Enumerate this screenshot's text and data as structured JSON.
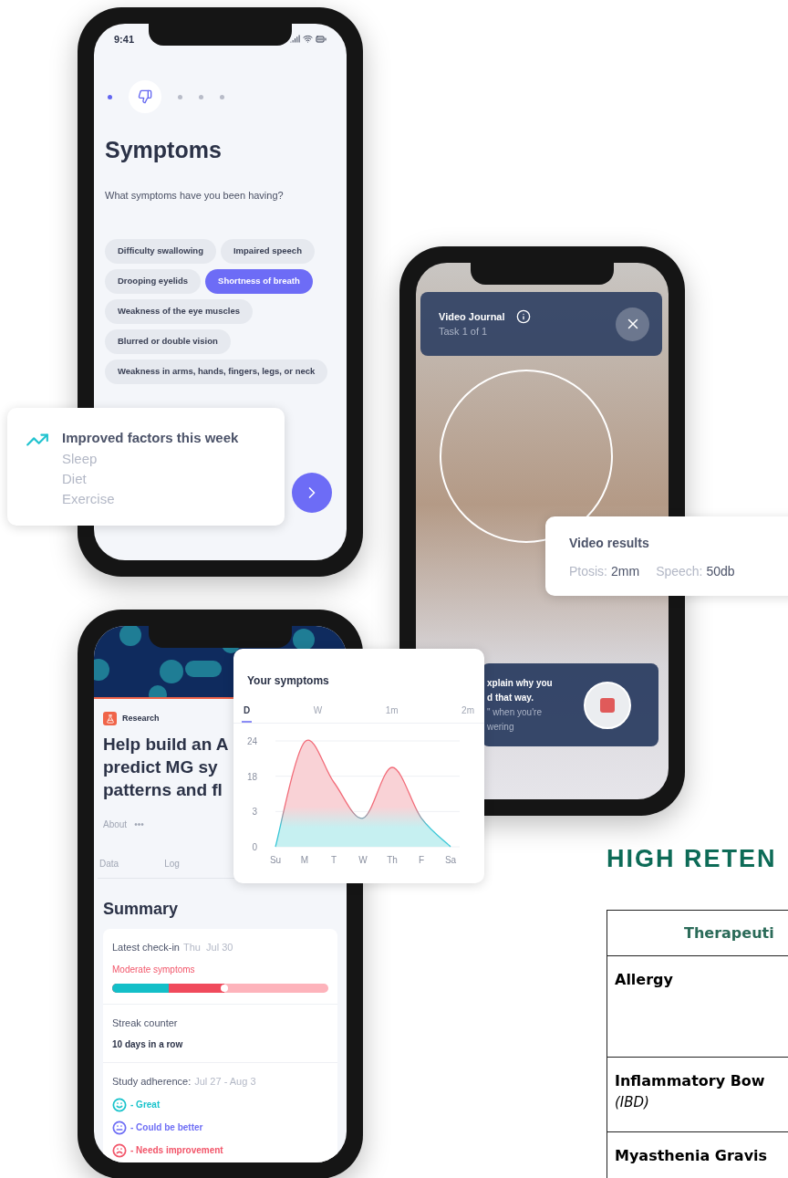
{
  "symptoms_phone": {
    "status_time": "9:41",
    "steps": [
      {
        "kind": "done"
      },
      {
        "kind": "current"
      },
      {
        "kind": "todo"
      },
      {
        "kind": "todo"
      },
      {
        "kind": "todo"
      }
    ],
    "title": "Symptoms",
    "question": "What symptoms have you been having?",
    "chips": [
      {
        "label": "Difficulty swallowing",
        "selected": false
      },
      {
        "label": "Impaired speech",
        "selected": false
      },
      {
        "label": "Drooping eyelids",
        "selected": false
      },
      {
        "label": "Shortness of breath",
        "selected": true
      },
      {
        "label": "Weakness of the eye muscles",
        "selected": false
      },
      {
        "label": "Blurred or double vision",
        "selected": false
      },
      {
        "label": "Weakness in arms, hands, fingers, legs, or neck",
        "selected": false
      }
    ]
  },
  "improved_card": {
    "title": "Improved factors this week",
    "items": [
      "Sleep",
      "Diet",
      "Exercise"
    ]
  },
  "video_phone": {
    "header_title": "Video Journal",
    "header_subtitle": "Task 1 of 1",
    "prompt_lines": [
      "xplain why you",
      "d that way.",
      "\" when you're",
      "wering"
    ]
  },
  "video_results": {
    "title": "Video results",
    "metrics": [
      {
        "label": "Ptosis:",
        "value": "2mm"
      },
      {
        "label": "Speech:",
        "value": "50db"
      }
    ]
  },
  "research_phone": {
    "badge": "Research",
    "title_lines": [
      "Help build an A",
      "predict MG sy",
      "patterns and fl"
    ],
    "about": "About",
    "more": "•••",
    "tabs": [
      "Data",
      "Log"
    ],
    "summary_title": "Summary",
    "checkin": {
      "label": "Latest check-in",
      "date": "Thu  Jul 30",
      "status": "Moderate symptoms",
      "level": 0.52
    },
    "streak": {
      "label": "Streak counter",
      "value": "10 days in a row"
    },
    "adherence": {
      "label": "Study adherence:",
      "range": "Jul 27 - Aug 3",
      "items": [
        {
          "kind": "happy",
          "label": "- Great",
          "color": "#19c3cb"
        },
        {
          "kind": "neutral",
          "label": "- Could be better",
          "color": "#6e6ef5"
        },
        {
          "kind": "sad",
          "label": "- Needs improvement",
          "color": "#f2566a"
        }
      ]
    }
  },
  "symptoms_chart": {
    "title": "Your symptoms",
    "tabs": [
      {
        "label": "D",
        "selected": true
      },
      {
        "label": "W",
        "selected": false
      },
      {
        "label": "1m",
        "selected": false
      },
      {
        "label": "2m",
        "selected": false
      }
    ],
    "x_axis_labels": [
      "Su",
      "M",
      "T",
      "W",
      "Th",
      "F",
      "Sa"
    ],
    "y_axis_labels": [
      "24",
      "18",
      "3",
      "0"
    ]
  },
  "heading": "HIGH RETEN",
  "table": {
    "columns": [
      "Therapeuti"
    ],
    "rows": [
      {
        "name": "Allergy"
      },
      {
        "name": "Inflammatory Bow",
        "note": "(IBD)"
      },
      {
        "name": "Myasthenia Gravis"
      }
    ]
  }
}
